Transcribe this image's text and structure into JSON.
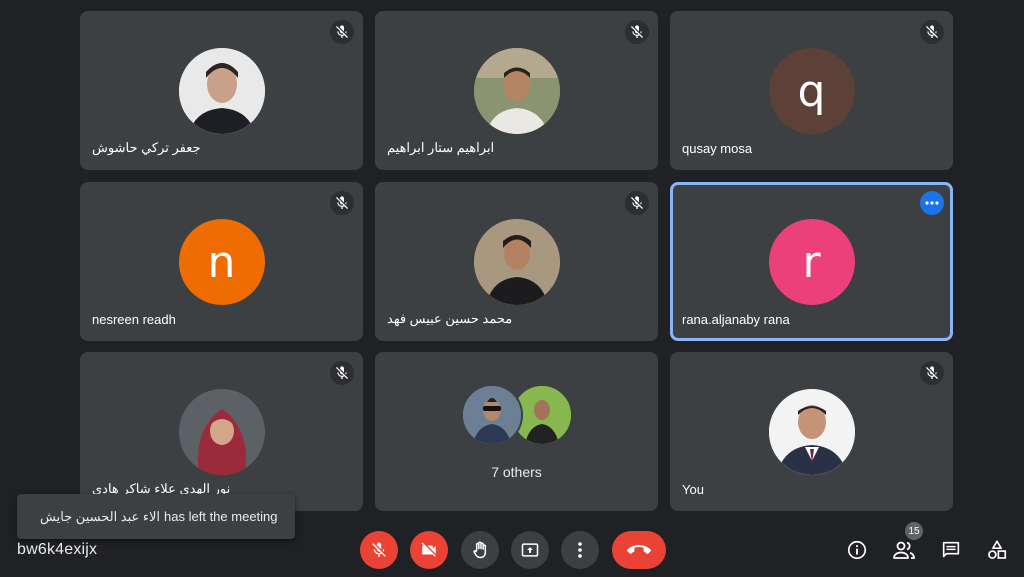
{
  "meeting_code": "bw6k4exijx",
  "toast": {
    "name": "الاء عبد الحسين جايش",
    "message": "has left the meeting"
  },
  "participants": [
    {
      "name": "جعفر تركي حاشوش",
      "avatar": "photo",
      "muted": true
    },
    {
      "name": "ابراهيم ستار ابراهيم",
      "avatar": "photo",
      "muted": true
    },
    {
      "name": "qusay mosa",
      "avatar": "letter",
      "letter": "q",
      "color": "#5d4037",
      "muted": true
    },
    {
      "name": "nesreen readh",
      "avatar": "letter",
      "letter": "n",
      "color": "#ef6c00",
      "muted": true
    },
    {
      "name": "محمد حسين عبيس فهد",
      "avatar": "photo",
      "muted": true
    },
    {
      "name": "rana.aljanaby rana",
      "avatar": "letter",
      "letter": "r",
      "color": "#ec407a",
      "muted": false,
      "active": true
    },
    {
      "name": "نور الهدى علاء شاكر هادي",
      "avatar": "photo",
      "muted": true
    },
    {
      "others_label": "7 others"
    },
    {
      "name": "You",
      "avatar": "photo",
      "muted": true
    }
  ],
  "controls": {
    "participants_count": "15",
    "buttons": [
      "mic-off",
      "camera-off",
      "raise-hand",
      "present-screen",
      "more-options",
      "end-call"
    ],
    "right_buttons": [
      "meeting-details",
      "people",
      "chat",
      "activities"
    ]
  },
  "colors": {
    "background": "#202124",
    "tile": "#3c4043",
    "red": "#ea4335",
    "active_border": "#8ab4f8",
    "blue": "#1a73e8"
  }
}
